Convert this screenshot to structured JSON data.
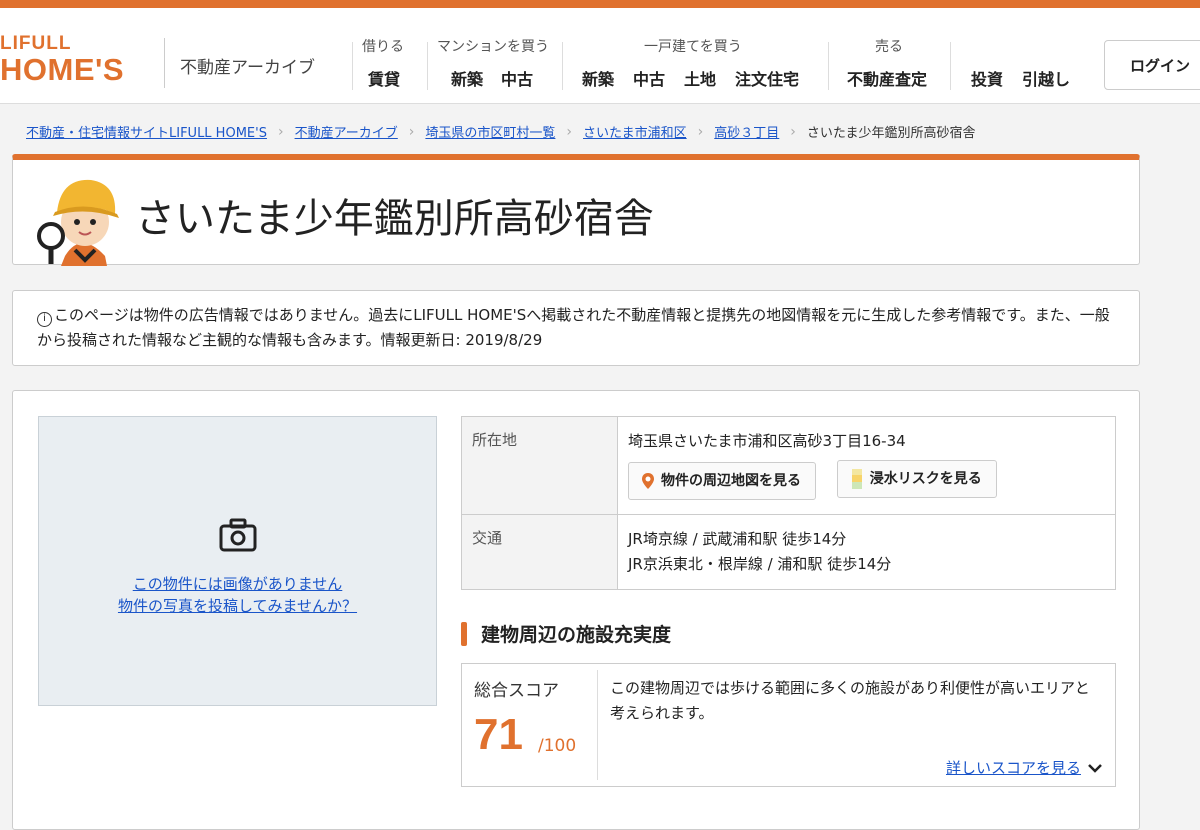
{
  "header": {
    "logo_line1": "LIFULL",
    "logo_line2": "HOME'S",
    "archive_label": "不動産アーカイブ",
    "nav": [
      {
        "caption": "借りる",
        "items": [
          "賃貸"
        ]
      },
      {
        "caption": "マンションを買う",
        "items": [
          "新築",
          "中古"
        ]
      },
      {
        "caption": "一戸建てを買う",
        "items": [
          "新築",
          "中古",
          "土地",
          "注文住宅"
        ]
      },
      {
        "caption": "売る",
        "items": [
          "不動産査定"
        ]
      },
      {
        "caption": "",
        "items": [
          "投資",
          "引越し"
        ]
      }
    ],
    "login_label": "ログイン"
  },
  "breadcrumb": {
    "items": [
      "不動産・住宅情報サイトLIFULL HOME'S",
      "不動産アーカイブ",
      "埼玉県の市区町村一覧",
      "さいたま市浦和区",
      "高砂３丁目"
    ],
    "current": "さいたま少年鑑別所高砂宿舎"
  },
  "page_title": "さいたま少年鑑別所高砂宿舎",
  "notice": {
    "icon": "info-icon",
    "text": "このページは物件の広告情報ではありません。過去にLIFULL HOME'Sへ掲載された不動産情報と提携先の地図情報を元に生成した参考情報です。また、一般から投稿された情報など主観的な情報も含みます。情報更新日: 2019/8/29"
  },
  "photo": {
    "icon": "camera-icon",
    "no_image_text": "この物件には画像がありません",
    "post_photo_text": "物件の写真を投稿してみませんか？"
  },
  "info": {
    "address_label": "所在地",
    "address_value": "埼玉県さいたま市浦和区高砂3丁目16-34",
    "map_button": "物件の周辺地図を見る",
    "flood_button": "浸水リスクを見る",
    "transport_label": "交通",
    "transport_lines": [
      "JR埼京線 / 武蔵浦和駅 徒歩14分",
      "JR京浜東北・根岸線 / 浦和駅 徒歩14分"
    ]
  },
  "facility": {
    "section_title": "建物周辺の施設充実度",
    "score_label": "総合スコア",
    "score_value": "71",
    "score_max": "/100",
    "description": "この建物周辺では歩ける範囲に多くの施設があり利便性が高いエリアと考えられます。",
    "details_link": "詳しいスコアを見る"
  },
  "colors": {
    "brand": "#e0712e",
    "link": "#1a55c9"
  }
}
